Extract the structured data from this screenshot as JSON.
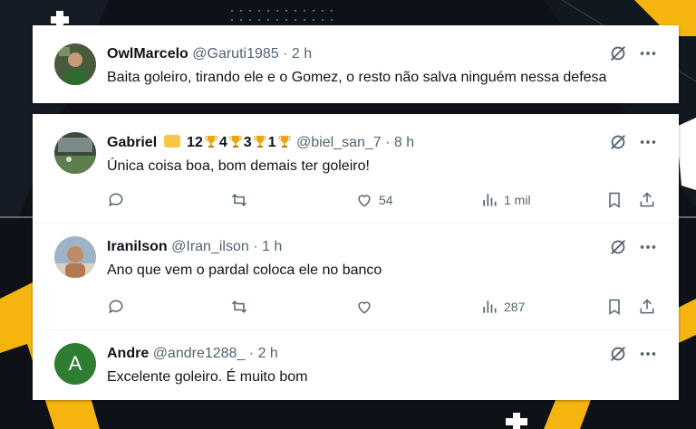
{
  "tweets": [
    {
      "name": "OwlMarcelo",
      "handle": "@Garuti1985",
      "time": "· 2 h",
      "text": "Baita goleiro, tirando ele e o Gomez, o resto não salva ninguém nessa defesa"
    },
    {
      "name": "Gabriel",
      "badges": [
        "12",
        "4",
        "3",
        "1"
      ],
      "handle": "@biel_san_7",
      "time": "· 8 h",
      "text": "Única coisa boa, bom demais ter goleiro!",
      "likes": "54",
      "views": "1 mil"
    },
    {
      "name": "Iranilson",
      "handle": "@Iran_ilson",
      "time": "· 1 h",
      "text": "Ano que vem o pardal coloca ele no banco",
      "views": "287"
    },
    {
      "name": "Andre",
      "handle": "@andre1288_",
      "time": "· 2 h",
      "text": "Excelente goleiro. É muito bom",
      "avatar_letter": "A"
    }
  ],
  "colors": {
    "avatar_green": "#2e7d32",
    "icon_grey": "#536471",
    "accent_yellow": "#f6b40e"
  }
}
